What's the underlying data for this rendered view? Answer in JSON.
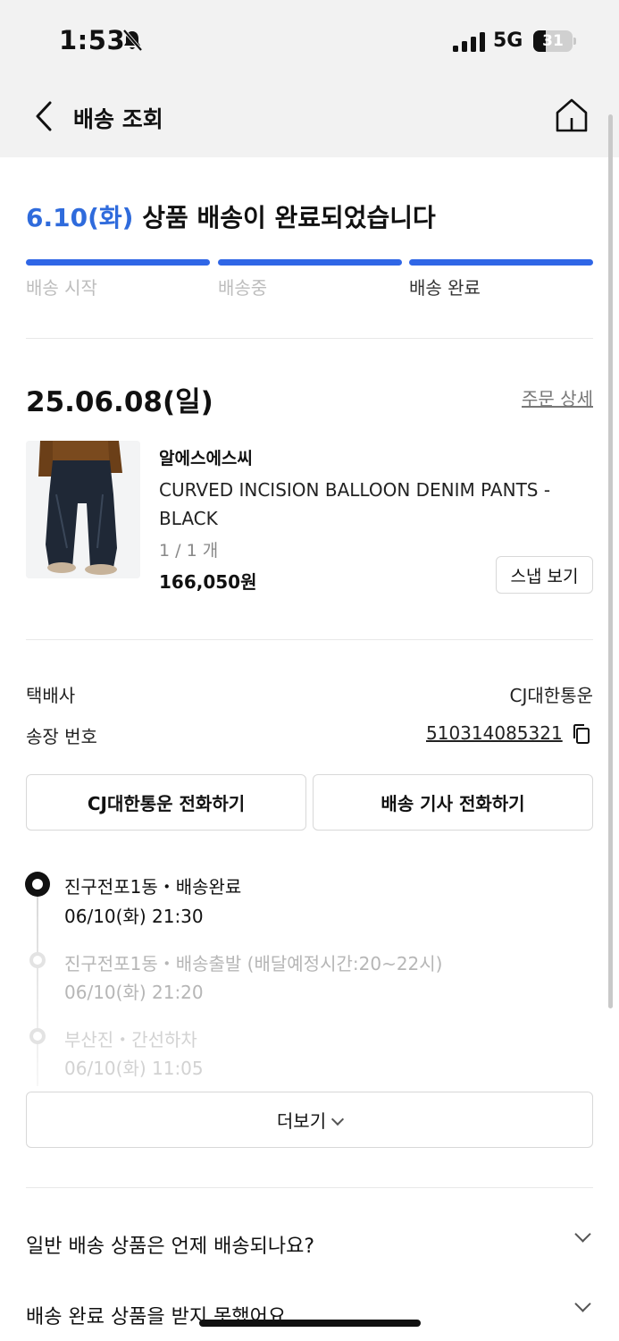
{
  "status_bar": {
    "time": "1:53",
    "network": "5G",
    "battery_level": "31",
    "battery_fraction": 0.31,
    "icons": [
      "bell-muted-icon",
      "cellular-signal-icon",
      "battery-icon"
    ]
  },
  "header": {
    "title": "배송 조회",
    "back_icon": "chevron-left-icon",
    "home_icon": "home-icon"
  },
  "delivery_status": {
    "date": "6.10(화)",
    "message": " 상품 배송이 완료되었습니다",
    "progress_color": "#2f66e6",
    "date_color": "#2f6bdc",
    "steps": [
      {
        "label": "배송 시작",
        "complete": true
      },
      {
        "label": "배송중",
        "complete": true
      },
      {
        "label": "배송 완료",
        "complete": true,
        "current": true
      }
    ]
  },
  "order": {
    "date": "25.06.08(일)",
    "detail_link": "주문 상세",
    "brand": "알에스에스씨",
    "product_name": "CURVED INCISION BALLOON DENIM PANTS - BLACK",
    "quantity": "1 / 1 개",
    "price": "166,050원",
    "snap_button": "스냅 보기"
  },
  "shipping": {
    "carrier_label": "택배사",
    "carrier_value": "CJ대한통운",
    "tracking_label": "송장 번호",
    "tracking_number": "510314085321",
    "call_carrier_button": "CJ대한통운 전화하기",
    "call_driver_button": "배송 기사 전화하기"
  },
  "tracking_events": [
    {
      "title": "진구전포1동・배송완료",
      "time": "06/10(화) 21:30"
    },
    {
      "title": "진구전포1동・배송출발 (배달예정시간:20~22시)",
      "time": "06/10(화) 21:20"
    },
    {
      "title": "부산진・간선하차",
      "time": "06/10(화) 11:05"
    }
  ],
  "more_button": "더보기",
  "faq": [
    {
      "question": "일반 배송 상품은 언제 배송되나요?"
    },
    {
      "question": "배송 완료 상품을 받지 못했어요."
    }
  ]
}
